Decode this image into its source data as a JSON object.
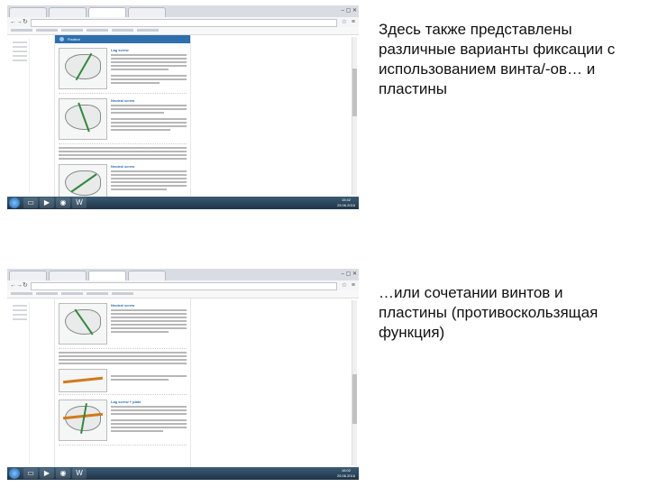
{
  "slide": {
    "caption_top": "Здесь также представлены различные варианты фиксации с использованием винта/-ов… и пластины",
    "caption_bottom": "…или сочетании винтов и пластины (противоскользящая функция)"
  },
  "screenshots": [
    {
      "header": "Fixation",
      "sections": [
        "Lag screw",
        "Neutral screw",
        "Neutral screw"
      ],
      "clock": {
        "time": "15:42",
        "date": "25.06.2016"
      }
    },
    {
      "header": "",
      "sections": [
        "Neutral screw",
        "",
        "Lag screw + plate"
      ],
      "clock": {
        "time": "16:02",
        "date": "25.06.2016"
      }
    }
  ],
  "icons": {
    "back": "back-arrow-icon",
    "forward": "forward-arrow-icon",
    "reload": "reload-icon",
    "star": "star-icon",
    "menu": "menu-icon",
    "start": "windows-start-icon",
    "browser": "chrome-icon",
    "explorer": "folder-icon",
    "media": "media-player-icon",
    "word": "word-icon"
  },
  "colors": {
    "accent": "#2e6fae",
    "taskbar": "#1f3447",
    "screw": "#2f8a3c",
    "plate": "#d07a1a"
  }
}
